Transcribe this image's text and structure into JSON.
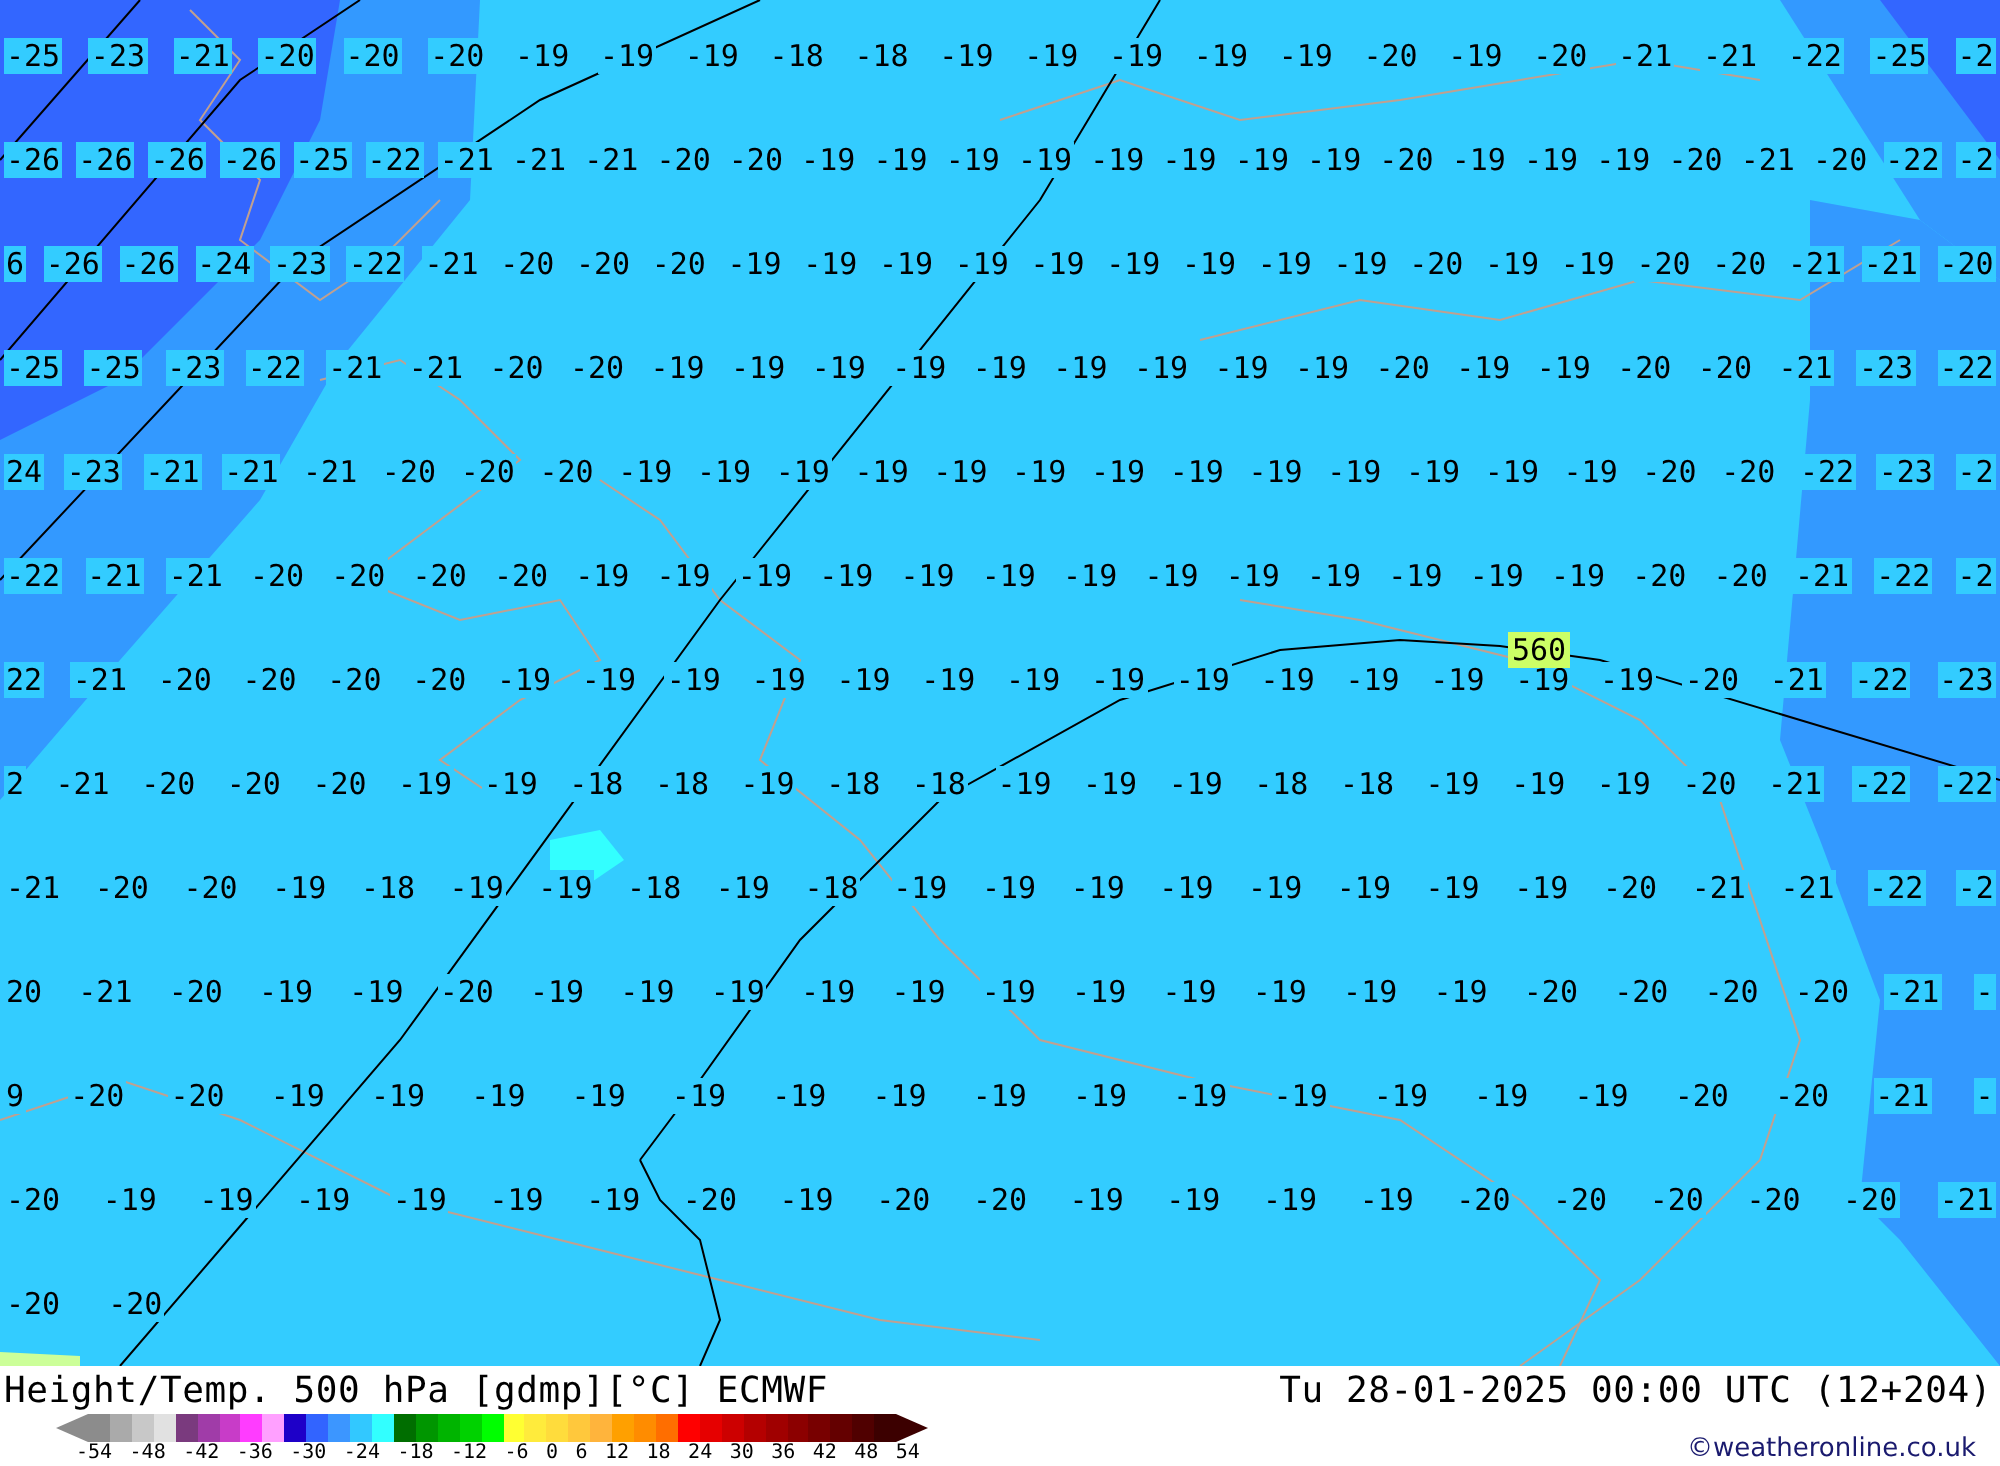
{
  "map": {
    "temperature_rows": [
      [
        "-25",
        "-23",
        "-21",
        "-20",
        "-20",
        "-20",
        "-19",
        "-19",
        "-19",
        "-18",
        "-18",
        "-19",
        "-19",
        "-19",
        "-19",
        "-19",
        "-20",
        "-19",
        "-20",
        "-21",
        "-21",
        "-22",
        "-25",
        "-2"
      ],
      [
        "-26",
        "-26",
        "-26",
        "-26",
        "-25",
        "-22",
        "-21",
        "-21",
        "-21",
        "-20",
        "-20",
        "-19",
        "-19",
        "-19",
        "-19",
        "-19",
        "-19",
        "-19",
        "-19",
        "-20",
        "-19",
        "-19",
        "-19",
        "-20",
        "-21",
        "-20",
        "-22",
        "-2"
      ],
      [
        "6",
        "-26",
        "-26",
        "-24",
        "-23",
        "-22",
        "-21",
        "-20",
        "-20",
        "-20",
        "-19",
        "-19",
        "-19",
        "-19",
        "-19",
        "-19",
        "-19",
        "-19",
        "-19",
        "-20",
        "-19",
        "-19",
        "-20",
        "-20",
        "-21",
        "-21",
        "-20"
      ],
      [
        "-25",
        "-25",
        "-23",
        "-22",
        "-21",
        "-21",
        "-20",
        "-20",
        "-19",
        "-19",
        "-19",
        "-19",
        "-19",
        "-19",
        "-19",
        "-19",
        "-19",
        "-20",
        "-19",
        "-19",
        "-20",
        "-20",
        "-21",
        "-23",
        "-22"
      ],
      [
        "24",
        "-23",
        "-21",
        "-21",
        "-21",
        "-20",
        "-20",
        "-20",
        "-19",
        "-19",
        "-19",
        "-19",
        "-19",
        "-19",
        "-19",
        "-19",
        "-19",
        "-19",
        "-19",
        "-19",
        "-19",
        "-20",
        "-20",
        "-22",
        "-23",
        "-2"
      ],
      [
        "-22",
        "-21",
        "-21",
        "-20",
        "-20",
        "-20",
        "-20",
        "-19",
        "-19",
        "-19",
        "-19",
        "-19",
        "-19",
        "-19",
        "-19",
        "-19",
        "-19",
        "-19",
        "-19",
        "-19",
        "-20",
        "-20",
        "-21",
        "-22",
        "-2"
      ],
      [
        "22",
        "-21",
        "-20",
        "-20",
        "-20",
        "-20",
        "-19",
        "-19",
        "-19",
        "-19",
        "-19",
        "-19",
        "-19",
        "-19",
        "-19",
        "-19",
        "-19",
        "-19",
        "-19",
        "-19",
        "-20",
        "-21",
        "-22",
        "-23"
      ],
      [
        "2",
        "-21",
        "-20",
        "-20",
        "-20",
        "-19",
        "-19",
        "-18",
        "-18",
        "-19",
        "-18",
        "-18",
        "-19",
        "-19",
        "-19",
        "-18",
        "-18",
        "-19",
        "-19",
        "-19",
        "-20",
        "-21",
        "-22",
        "-22"
      ],
      [
        "-21",
        "-20",
        "-20",
        "-19",
        "-18",
        "-19",
        "-19",
        "-18",
        "-19",
        "-18",
        "-19",
        "-19",
        "-19",
        "-19",
        "-19",
        "-19",
        "-19",
        "-19",
        "-20",
        "-21",
        "-21",
        "-22",
        "-2"
      ],
      [
        "20",
        "-21",
        "-20",
        "-19",
        "-19",
        "-20",
        "-19",
        "-19",
        "-19",
        "-19",
        "-19",
        "-19",
        "-19",
        "-19",
        "-19",
        "-19",
        "-19",
        "-20",
        "-20",
        "-20",
        "-20",
        "-21",
        "-"
      ],
      [
        "9",
        "-20",
        "-20",
        "-19",
        "-19",
        "-19",
        "-19",
        "-19",
        "-19",
        "-19",
        "-19",
        "-19",
        "-19",
        "-19",
        "-19",
        "-19",
        "-19",
        "-20",
        "-20",
        "-21",
        "-"
      ],
      [
        "-20",
        "-19",
        "-19",
        "-19",
        "-19",
        "-19",
        "-19",
        "-20",
        "-19",
        "-20",
        "-20",
        "-19",
        "-19",
        "-19",
        "-19",
        "-20",
        "-20",
        "-20",
        "-20",
        "-20",
        "-21"
      ],
      [
        "-20",
        "-20"
      ]
    ],
    "height_label": "560"
  },
  "footer": {
    "title": "Height/Temp. 500 hPa [gdmp][°C] ECMWF",
    "valid_time": "Tu 28-01-2025 00:00 UTC (12+204)",
    "legend": {
      "swatches": [
        {
          "color": "#8c8c8c"
        },
        {
          "color": "#aaaaaa"
        },
        {
          "color": "#c8c8c8"
        },
        {
          "color": "#e1e1e1"
        },
        {
          "color": "#7a3a7e"
        },
        {
          "color": "#a03ca8"
        },
        {
          "color": "#c83cc8"
        },
        {
          "color": "#ff3cff"
        },
        {
          "color": "#ffa0ff"
        },
        {
          "color": "#1e00c8"
        },
        {
          "color": "#3264ff"
        },
        {
          "color": "#3c96ff"
        },
        {
          "color": "#32c8ff"
        },
        {
          "color": "#32ffff"
        },
        {
          "color": "#006e00"
        },
        {
          "color": "#009600"
        },
        {
          "color": "#00b400"
        },
        {
          "color": "#00d200"
        },
        {
          "color": "#00ff00"
        },
        {
          "color": "#ffff32"
        },
        {
          "color": "#ffeb3c"
        },
        {
          "color": "#ffdc3c"
        },
        {
          "color": "#ffc83c"
        },
        {
          "color": "#ffb43c"
        },
        {
          "color": "#ffa000"
        },
        {
          "color": "#ff8c00"
        },
        {
          "color": "#ff6e00"
        },
        {
          "color": "#ff0000"
        },
        {
          "color": "#e60000"
        },
        {
          "color": "#cd0000"
        },
        {
          "color": "#b40000"
        },
        {
          "color": "#a00000"
        },
        {
          "color": "#8c0000"
        },
        {
          "color": "#780000"
        },
        {
          "color": "#640000"
        },
        {
          "color": "#500000"
        },
        {
          "color": "#3c0000"
        }
      ],
      "ticks": [
        "-54",
        "-48",
        "-42",
        "-36",
        "-30",
        "-24",
        "-18",
        "-12",
        "-6",
        "0",
        "6",
        "12",
        "18",
        "24",
        "30",
        "36",
        "42",
        "48",
        "54"
      ]
    },
    "credit": "©weatheronline.co.uk"
  }
}
